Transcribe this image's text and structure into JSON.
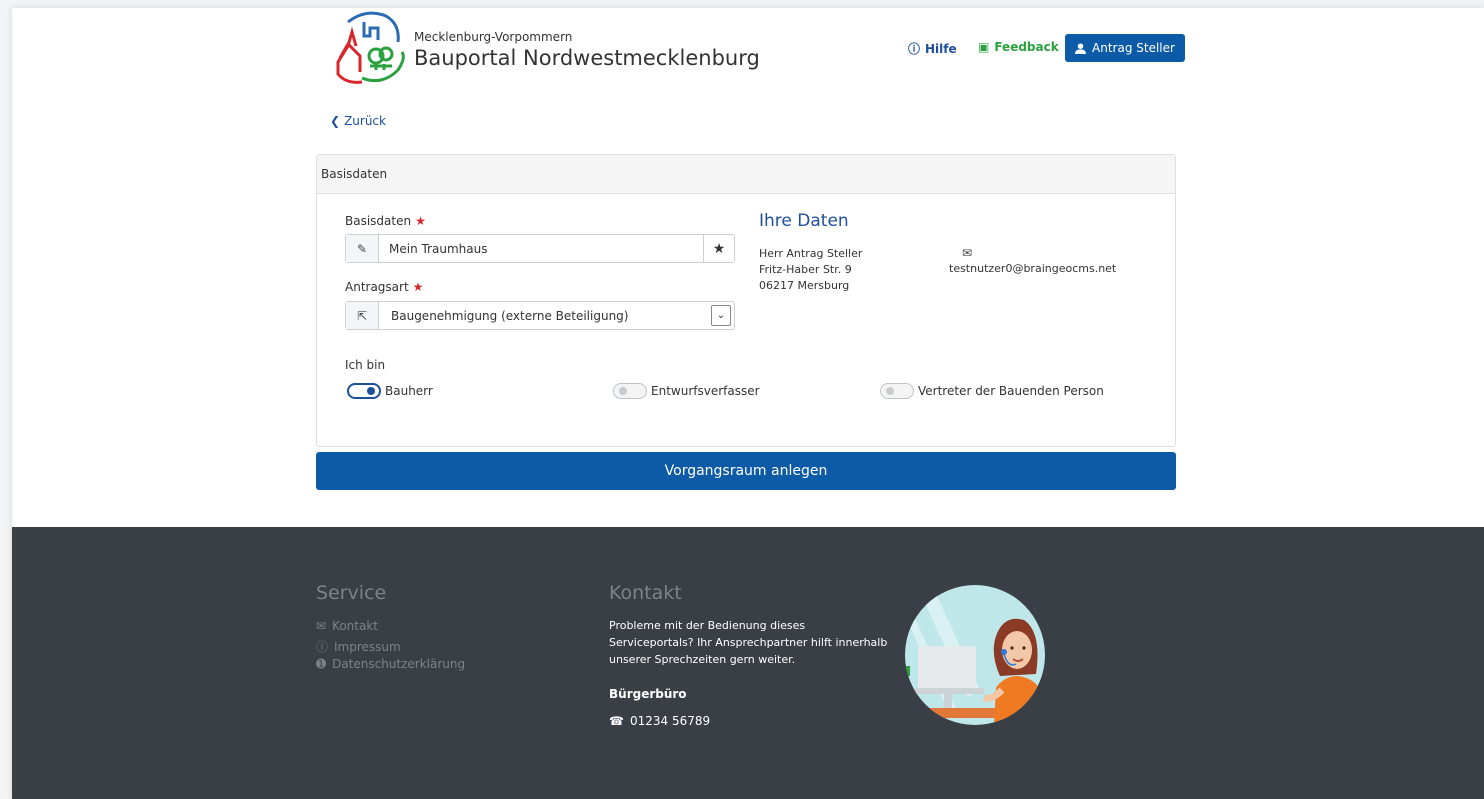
{
  "header": {
    "subtitle": "Mecklenburg-Vorpommern",
    "title": "Bauportal Nordwestmecklenburg",
    "help_label": "Hilfe",
    "feedback_label": "Feedback",
    "user_label": "Antrag Steller"
  },
  "nav": {
    "back_label": "Zurück"
  },
  "panel": {
    "heading": "Basisdaten",
    "name_label": "Basisdaten",
    "name_value": "Mein Traumhaus",
    "type_label": "Antragsart",
    "type_value": "Baugenehmigung (externe Beteiligung)",
    "role_label": "Ich bin",
    "roles": [
      {
        "label": "Bauherr",
        "active": true
      },
      {
        "label": "Entwurfsverfasser",
        "active": false
      },
      {
        "label": "Vertreter der Bauenden Person",
        "active": false
      }
    ],
    "your_data": {
      "title": "Ihre Daten",
      "name": "Herr Antrag Steller",
      "street": "Fritz-Haber Str. 9",
      "city": "06217 Mersburg",
      "email": "testnutzer0@braingeocms.net"
    }
  },
  "submit_label": "Vorgangsraum anlegen",
  "footer": {
    "service_title": "Service",
    "links": [
      "Kontakt",
      "Impressum",
      "Datenschutzerklärung"
    ],
    "contact_title": "Kontakt",
    "contact_text": "Probleme mit der Bedienung dieses Serviceportals? Ihr Ansprechpartner hilft innerhalb unserer Sprechzeiten gern weiter.",
    "office": "Bürgerbüro",
    "phone": "01234 56789"
  },
  "colors": {
    "primary": "#0d5aa7",
    "link": "#1c4f9c",
    "feedback": "#2aa13e",
    "footer_bg": "#3a3f45",
    "required": "#d9262c"
  }
}
